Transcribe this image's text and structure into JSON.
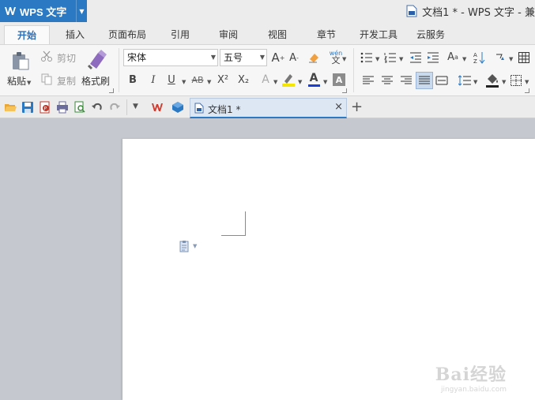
{
  "app": {
    "name": "WPS 文字",
    "window_title": "文档1 * - WPS 文字 - 兼"
  },
  "ribbon_tabs": [
    {
      "label": "开始",
      "active": true
    },
    {
      "label": "插入"
    },
    {
      "label": "页面布局"
    },
    {
      "label": "引用"
    },
    {
      "label": "审阅"
    },
    {
      "label": "视图"
    },
    {
      "label": "章节"
    },
    {
      "label": "开发工具"
    },
    {
      "label": "云服务"
    }
  ],
  "clipboard": {
    "paste_label": "粘贴",
    "cut_label": "剪切",
    "copy_label": "复制",
    "format_painter_label": "格式刷"
  },
  "font": {
    "family_value": "宋体",
    "size_value": "五号",
    "font_color": "#1a3fd6",
    "highlight_color": "#f5e600"
  },
  "formatting_glyphs": {
    "bold": "B",
    "italic": "I",
    "underline": "U",
    "strikethrough": "AB",
    "superscript": "X²",
    "subscript": "X₂",
    "font_color": "A",
    "grow_font": "A",
    "shrink_font": "A",
    "pinyin": "wén",
    "pinyin_char": "文"
  },
  "quick_access": {
    "document_tab_label": "文档1 *",
    "close_glyph": "×",
    "new_tab_glyph": "+"
  },
  "watermark": {
    "text": "Bai经验",
    "url": "jingyan.baidu.com"
  },
  "colors": {
    "accent": "#2b79c2",
    "active_tab_text": "#2b6fb8"
  }
}
